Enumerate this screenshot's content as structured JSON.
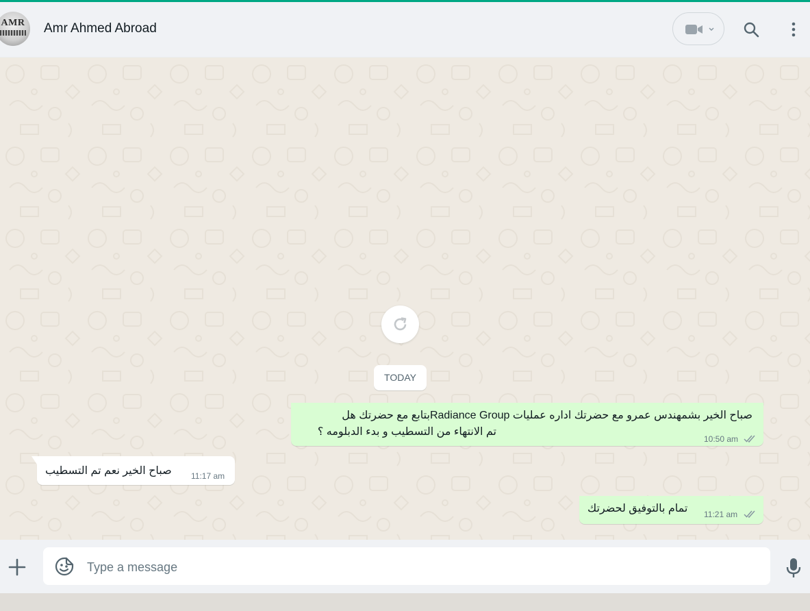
{
  "header": {
    "contact_name": "Amr Ahmed Abroad",
    "avatar_text": "AMR",
    "icons": [
      "video-camera-icon",
      "chevron-down-icon",
      "search-icon",
      "menu-dots-icon"
    ]
  },
  "chat": {
    "date_label": "TODAY",
    "messages": [
      {
        "direction": "outgoing",
        "line1": "صباح الخير بشمهندس  عمرو مع  حضرتك اداره عمليات Radiance Groupبتابع مع حضرتك هل",
        "line2": "تم الانتهاء من التسطيب و بدء الدبلومه ؟",
        "time": "10:50 am",
        "status": "read"
      },
      {
        "direction": "incoming",
        "text": "صباح الخير نعم تم التسطيب",
        "time": "11:17 am"
      },
      {
        "direction": "outgoing",
        "text": "تمام بالتوفيق لحضرتك",
        "time": "11:21 am",
        "status": "read"
      }
    ]
  },
  "composer": {
    "placeholder": "Type a message",
    "value": ""
  },
  "colors": {
    "accent": "#00a884",
    "outgoing_bubble": "#d9fdd3",
    "incoming_bubble": "#ffffff",
    "chat_background": "#efeae2",
    "read_ticks": "#8696a0"
  }
}
